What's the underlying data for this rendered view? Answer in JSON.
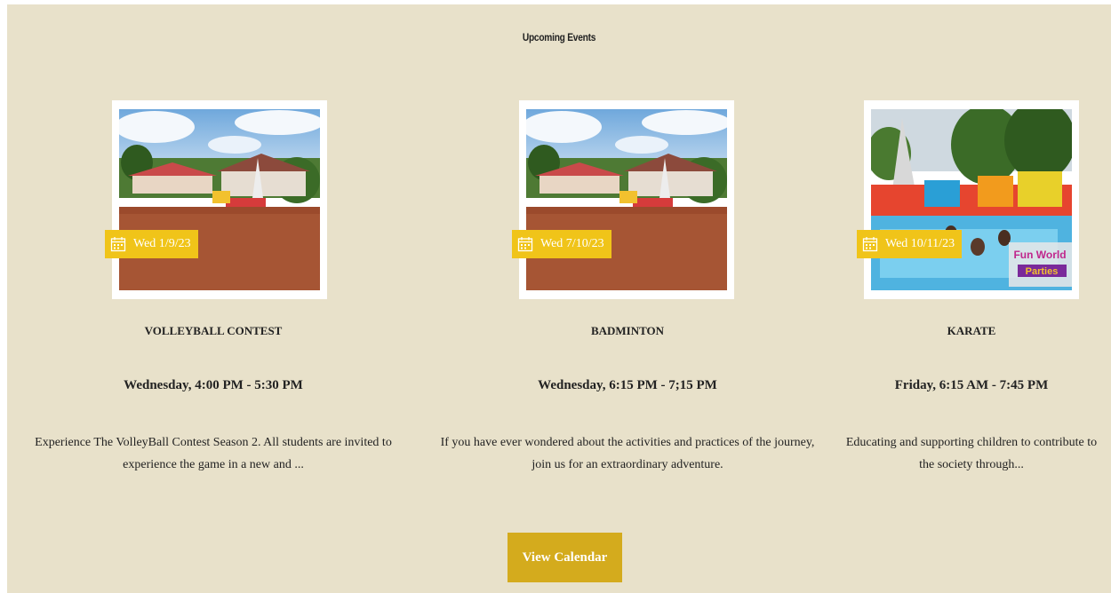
{
  "section": {
    "title": "Upcoming Events"
  },
  "events": [
    {
      "date": "Wed 1/9/23",
      "title": "VOLLEYBALL CONTEST",
      "time": "Wednesday, 4:00 PM - 5:30 PM",
      "description": "Experience The VolleyBall Contest Season 2. All students are invited to experience the game in a new and ..."
    },
    {
      "date": "Wed 7/10/23",
      "title": "BADMINTON",
      "time": "Wednesday, 6:15 PM - 7;15 PM",
      "description": "If you have ever wondered about the activities and practices of the journey, join us for an extraordinary adventure."
    },
    {
      "date": "Wed 10/11/23",
      "title": "KARATE",
      "time": "Friday, 6:15 AM - 7:45 PM",
      "description": "Educating and supporting children to contribute to the society through...",
      "image_text": {
        "line1": "Fun World",
        "line2": "Parties"
      }
    }
  ],
  "actions": {
    "view_calendar": "View Calendar"
  },
  "colors": {
    "section_bg": "#e8e1ca",
    "badge_bg": "#f0c419",
    "button_bg": "#d4ab1d"
  },
  "icons": {
    "date_badge": "calendar-icon"
  }
}
